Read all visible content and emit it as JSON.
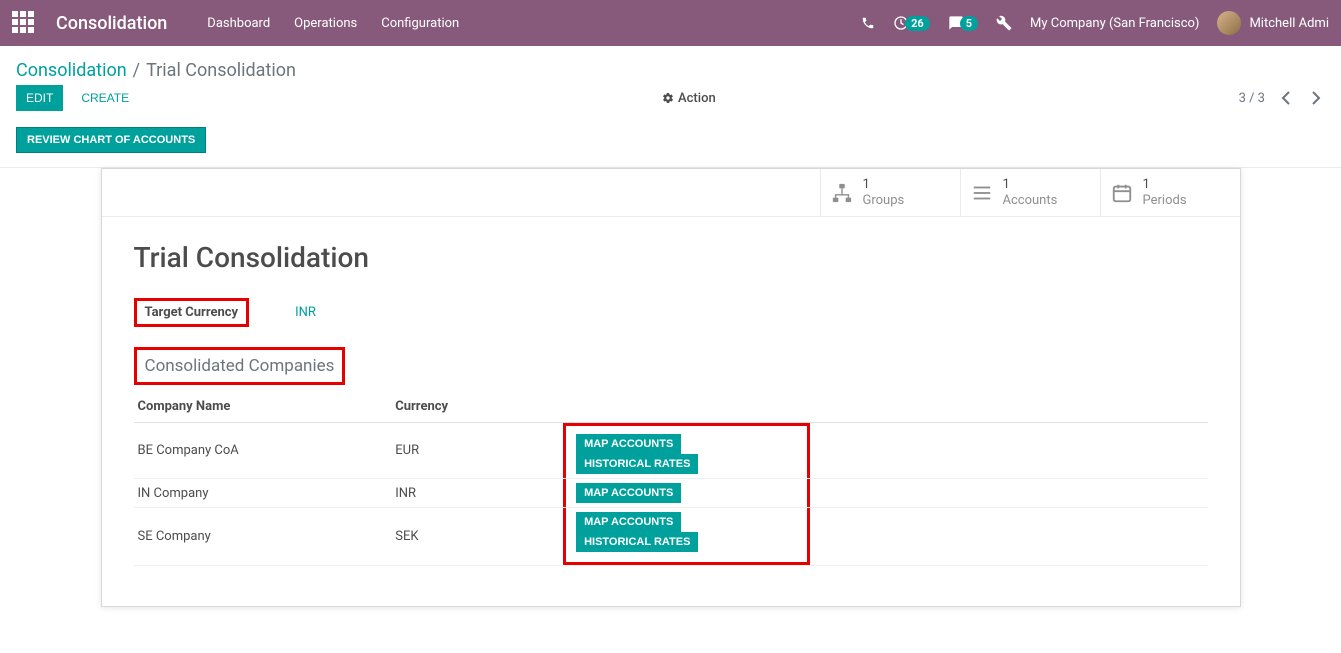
{
  "topbar": {
    "app_title": "Consolidation",
    "menu": [
      "Dashboard",
      "Operations",
      "Configuration"
    ],
    "activity_count": "26",
    "discuss_count": "5",
    "company": "My Company (San Francisco)",
    "user": "Mitchell Admi"
  },
  "breadcrumb": {
    "root": "Consolidation",
    "current": "Trial Consolidation"
  },
  "controls": {
    "edit": "Edit",
    "create": "Create",
    "action": "Action",
    "pager": "3 / 3"
  },
  "status": {
    "review_btn": "REVIEW CHART OF ACCOUNTS"
  },
  "stats": [
    {
      "value": "1",
      "label": "Groups",
      "icon": "sitemap"
    },
    {
      "value": "1",
      "label": "Accounts",
      "icon": "list"
    },
    {
      "value": "1",
      "label": "Periods",
      "icon": "calendar"
    }
  ],
  "record": {
    "title": "Trial Consolidation",
    "target_currency_label": "Target Currency",
    "target_currency_value": "INR",
    "section_title": "Consolidated Companies"
  },
  "table": {
    "headers": {
      "name": "Company Name",
      "currency": "Currency"
    },
    "rows": [
      {
        "name": "BE Company CoA",
        "currency": "EUR",
        "map": "MAP ACCOUNTS",
        "hist": "HISTORICAL RATES",
        "has_hist": true
      },
      {
        "name": "IN Company",
        "currency": "INR",
        "map": "MAP ACCOUNTS",
        "hist": "",
        "has_hist": false
      },
      {
        "name": "SE Company",
        "currency": "SEK",
        "map": "MAP ACCOUNTS",
        "hist": "HISTORICAL RATES",
        "has_hist": true
      }
    ]
  }
}
